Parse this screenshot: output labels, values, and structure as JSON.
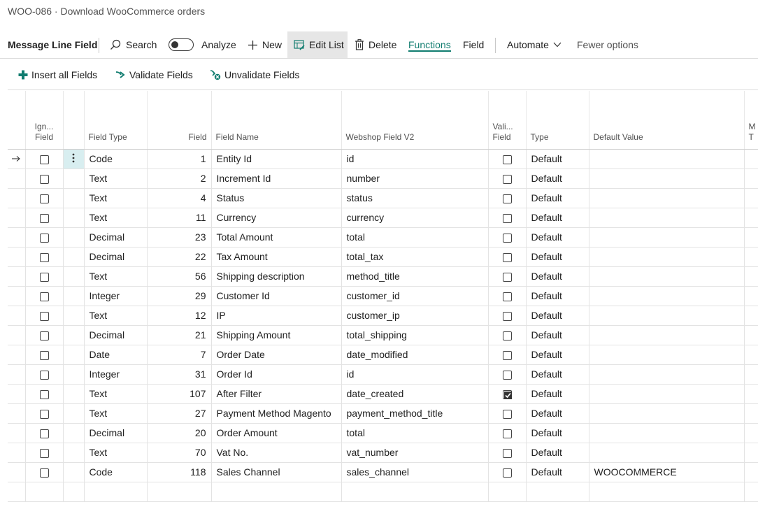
{
  "page": {
    "title": "WOO-086 · Download WooCommerce orders"
  },
  "actionbar": {
    "title": "Message Line Field",
    "search": "Search",
    "analyze": "Analyze",
    "new": "New",
    "edit_list": "Edit List",
    "delete": "Delete",
    "functions": "Functions",
    "field": "Field",
    "automate": "Automate",
    "fewer_options": "Fewer options"
  },
  "funcbar": {
    "insert_all": "Insert all Fields",
    "validate": "Validate Fields",
    "unvalidate": "Unvalidate Fields"
  },
  "columns": {
    "ignore_1": "Ign...",
    "ignore_2": "Field",
    "field_type": "Field Type",
    "field": "Field",
    "field_name": "Field Name",
    "webshop_field": "Webshop Field V2",
    "validate_1": "Vali...",
    "validate_2": "Field",
    "type": "Type",
    "default_value": "Default Value",
    "extra_1": "M",
    "extra_2": "T"
  },
  "rows": [
    {
      "field_type": "Code",
      "field": "1",
      "field_name": "Entity Id",
      "webshop_field": "id",
      "validate": false,
      "type": "Default",
      "default_value": ""
    },
    {
      "field_type": "Text",
      "field": "2",
      "field_name": "Increment Id",
      "webshop_field": "number",
      "validate": false,
      "type": "Default",
      "default_value": ""
    },
    {
      "field_type": "Text",
      "field": "4",
      "field_name": "Status",
      "webshop_field": "status",
      "validate": false,
      "type": "Default",
      "default_value": ""
    },
    {
      "field_type": "Text",
      "field": "11",
      "field_name": "Currency",
      "webshop_field": "currency",
      "validate": false,
      "type": "Default",
      "default_value": ""
    },
    {
      "field_type": "Decimal",
      "field": "23",
      "field_name": "Total Amount",
      "webshop_field": "total",
      "validate": false,
      "type": "Default",
      "default_value": ""
    },
    {
      "field_type": "Decimal",
      "field": "22",
      "field_name": "Tax Amount",
      "webshop_field": "total_tax",
      "validate": false,
      "type": "Default",
      "default_value": ""
    },
    {
      "field_type": "Text",
      "field": "56",
      "field_name": "Shipping description",
      "webshop_field": "method_title",
      "validate": false,
      "type": "Default",
      "default_value": ""
    },
    {
      "field_type": "Integer",
      "field": "29",
      "field_name": "Customer Id",
      "webshop_field": "customer_id",
      "validate": false,
      "type": "Default",
      "default_value": ""
    },
    {
      "field_type": "Text",
      "field": "12",
      "field_name": "IP",
      "webshop_field": "customer_ip",
      "validate": false,
      "type": "Default",
      "default_value": ""
    },
    {
      "field_type": "Decimal",
      "field": "21",
      "field_name": "Shipping Amount",
      "webshop_field": "total_shipping",
      "validate": false,
      "type": "Default",
      "default_value": ""
    },
    {
      "field_type": "Date",
      "field": "7",
      "field_name": "Order Date",
      "webshop_field": "date_modified",
      "validate": false,
      "type": "Default",
      "default_value": ""
    },
    {
      "field_type": "Integer",
      "field": "31",
      "field_name": "Order Id",
      "webshop_field": "id",
      "validate": false,
      "type": "Default",
      "default_value": ""
    },
    {
      "field_type": "Text",
      "field": "107",
      "field_name": "After Filter",
      "webshop_field": "date_created",
      "validate": true,
      "type": "Default",
      "default_value": ""
    },
    {
      "field_type": "Text",
      "field": "27",
      "field_name": "Payment Method Magento",
      "webshop_field": "payment_method_title",
      "validate": false,
      "type": "Default",
      "default_value": ""
    },
    {
      "field_type": "Decimal",
      "field": "20",
      "field_name": "Order Amount",
      "webshop_field": "total",
      "validate": false,
      "type": "Default",
      "default_value": ""
    },
    {
      "field_type": "Text",
      "field": "70",
      "field_name": "Vat No.",
      "webshop_field": "vat_number",
      "validate": false,
      "type": "Default",
      "default_value": ""
    },
    {
      "field_type": "Code",
      "field": "118",
      "field_name": "Sales Channel",
      "webshop_field": "sales_channel",
      "validate": false,
      "type": "Default",
      "default_value": "WOOCOMMERCE"
    }
  ],
  "colors": {
    "accent": "#107c6f",
    "active_cell": "#d8eef0"
  }
}
